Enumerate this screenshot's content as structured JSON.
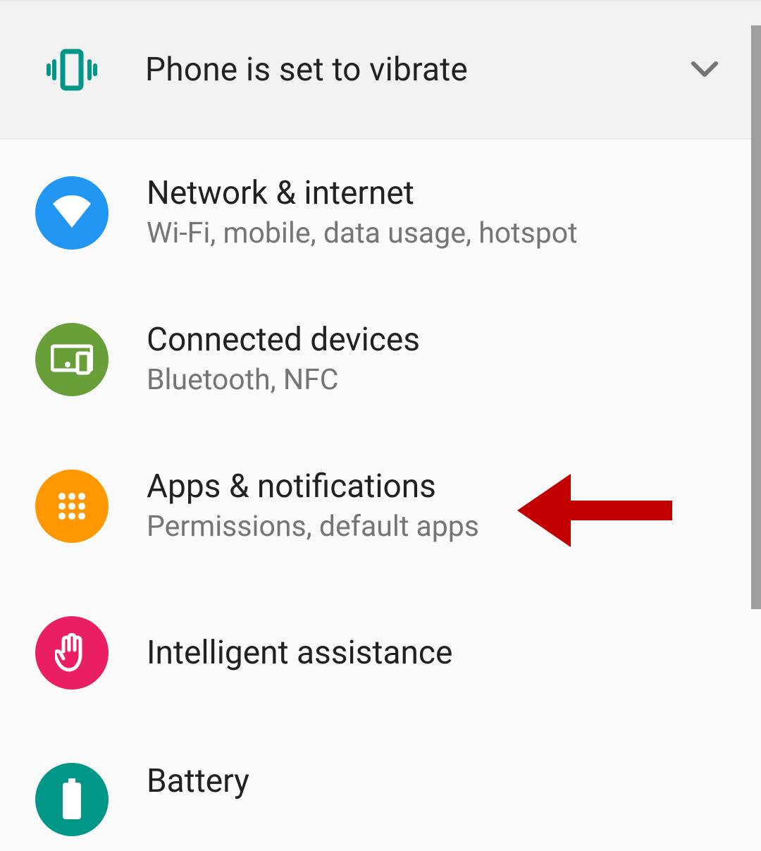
{
  "banner": {
    "title": "Phone is set to vibrate",
    "icon_name": "vibrate-icon",
    "chevron_name": "chevron-down-icon",
    "icon_color": "#009688"
  },
  "items": [
    {
      "title": "Network & internet",
      "subtitle": "Wi-Fi, mobile, data usage, hotspot",
      "icon_name": "wifi-icon",
      "bg": "#2196f3"
    },
    {
      "title": "Connected devices",
      "subtitle": "Bluetooth, NFC",
      "icon_name": "devices-icon",
      "bg": "#689f38"
    },
    {
      "title": "Apps & notifications",
      "subtitle": "Permissions, default apps",
      "icon_name": "apps-icon",
      "bg": "#ff9800"
    },
    {
      "title": "Intelligent assistance",
      "subtitle": "",
      "icon_name": "hand-icon",
      "bg": "#e91e63"
    },
    {
      "title": "Battery",
      "subtitle": "",
      "icon_name": "battery-icon",
      "bg": "#009688"
    }
  ],
  "annotation": {
    "name": "highlight-arrow",
    "target_item_index": 2,
    "color": "#c20000"
  }
}
